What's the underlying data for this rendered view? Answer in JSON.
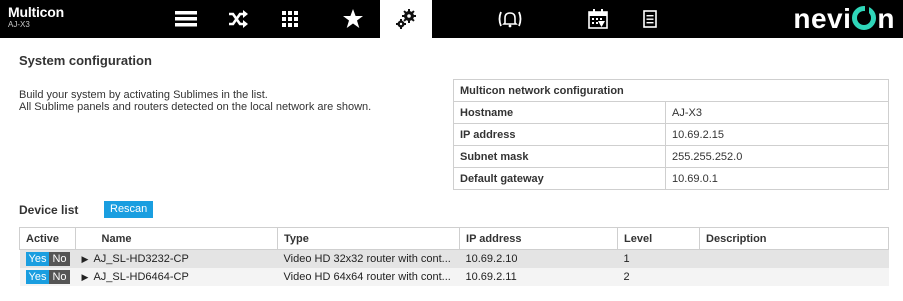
{
  "header": {
    "app_name": "Multicon",
    "device_name": "AJ-X3",
    "logo_text": "nevion",
    "nav": [
      {
        "name": "list-icon"
      },
      {
        "name": "crossover-icon"
      },
      {
        "name": "grid-icon"
      },
      {
        "name": "star-icon"
      },
      {
        "name": "gears-icon",
        "active": true
      },
      {
        "name": "alarm-bell-icon"
      },
      {
        "name": "calendar-icon"
      },
      {
        "name": "document-icon"
      }
    ],
    "accent_color": "#2fd6b9"
  },
  "page": {
    "title": "System configuration",
    "intro_line1": "Build your system by activating Sublimes in the list.",
    "intro_line2": "All Sublime panels and routers detected on the local network are shown."
  },
  "network": {
    "title": "Multicon network configuration",
    "rows": [
      {
        "key": "Hostname",
        "value": "AJ-X3"
      },
      {
        "key": "IP address",
        "value": "10.69.2.15"
      },
      {
        "key": "Subnet mask",
        "value": "255.255.252.0"
      },
      {
        "key": "Default gateway",
        "value": "10.69.0.1"
      }
    ]
  },
  "devices": {
    "title": "Device list",
    "rescan_label": "Rescan",
    "columns": [
      "Active",
      "Name",
      "Type",
      "IP address",
      "Level",
      "Description"
    ],
    "yes_label": "Yes",
    "no_label": "No",
    "rows": [
      {
        "name": "AJ_SL-HD3232-CP",
        "type": "Video HD 32x32 router with cont...",
        "ip": "10.69.2.10",
        "level": "1",
        "description": ""
      },
      {
        "name": "AJ_SL-HD6464-CP",
        "type": "Video HD 64x64 router with cont...",
        "ip": "10.69.2.11",
        "level": "2",
        "description": ""
      }
    ]
  },
  "colors": {
    "button_blue": "#1a9ee0",
    "toggle_off": "#555555"
  }
}
